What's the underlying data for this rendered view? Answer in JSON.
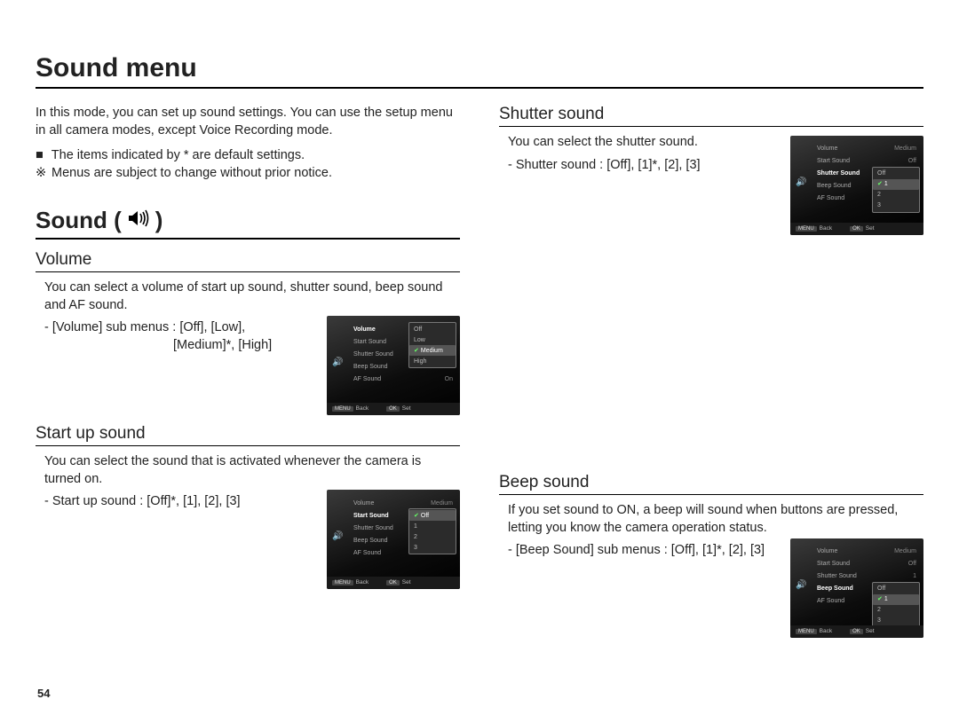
{
  "page_title": "Sound menu",
  "page_number": "54",
  "intro": "In this mode, you can set up sound settings. You can use the setup menu in all camera modes, except Voice Recording mode.",
  "notes": {
    "defaults_prefix": "■",
    "defaults": "The items indicated by * are default settings.",
    "change_prefix": "※",
    "change": "Menus are subject to change without prior notice."
  },
  "sound_heading": "Sound (",
  "sound_heading_close": ")",
  "icon_name": "speaker-icon",
  "sections": {
    "volume": {
      "title": "Volume",
      "desc": "You can select a volume of start up sound, shutter sound, beep sound and AF sound.",
      "line1": "- [Volume] sub menus : [Off], [Low],",
      "line2": "[Medium]*, [High]"
    },
    "startup": {
      "title": "Start up sound",
      "desc": "You can select the sound that is activated whenever the camera is turned on.",
      "line1": "- Start up sound : [Off]*, [1], [2], [3]"
    },
    "shutter": {
      "title": "Shutter sound",
      "desc": "You can select the shutter sound.",
      "line1": "- Shutter sound : [Off], [1]*, [2], [3]"
    },
    "beep": {
      "title": "Beep sound",
      "desc": "If you set sound to ON, a beep will sound when buttons are pressed, letting you know the camera operation status.",
      "line1": "- [Beep Sound] sub menus : [Off], [1]*, [2], [3]"
    }
  },
  "lcd": {
    "items": {
      "volume": "Volume",
      "start": "Start Sound",
      "shutter": "Shutter Sound",
      "beep": "Beep Sound",
      "af": "AF Sound"
    },
    "values": {
      "medium": "Medium",
      "off": "Off",
      "one": "1",
      "on": "On"
    },
    "popup_volume": {
      "a": "Off",
      "b": "Low",
      "c": "Medium",
      "d": "High"
    },
    "popup_0123": {
      "a": "Off",
      "b": "1",
      "c": "2",
      "d": "3"
    },
    "footer": {
      "back_btn": "MENU",
      "back": "Back",
      "set_btn": "OK",
      "set": "Set"
    }
  }
}
